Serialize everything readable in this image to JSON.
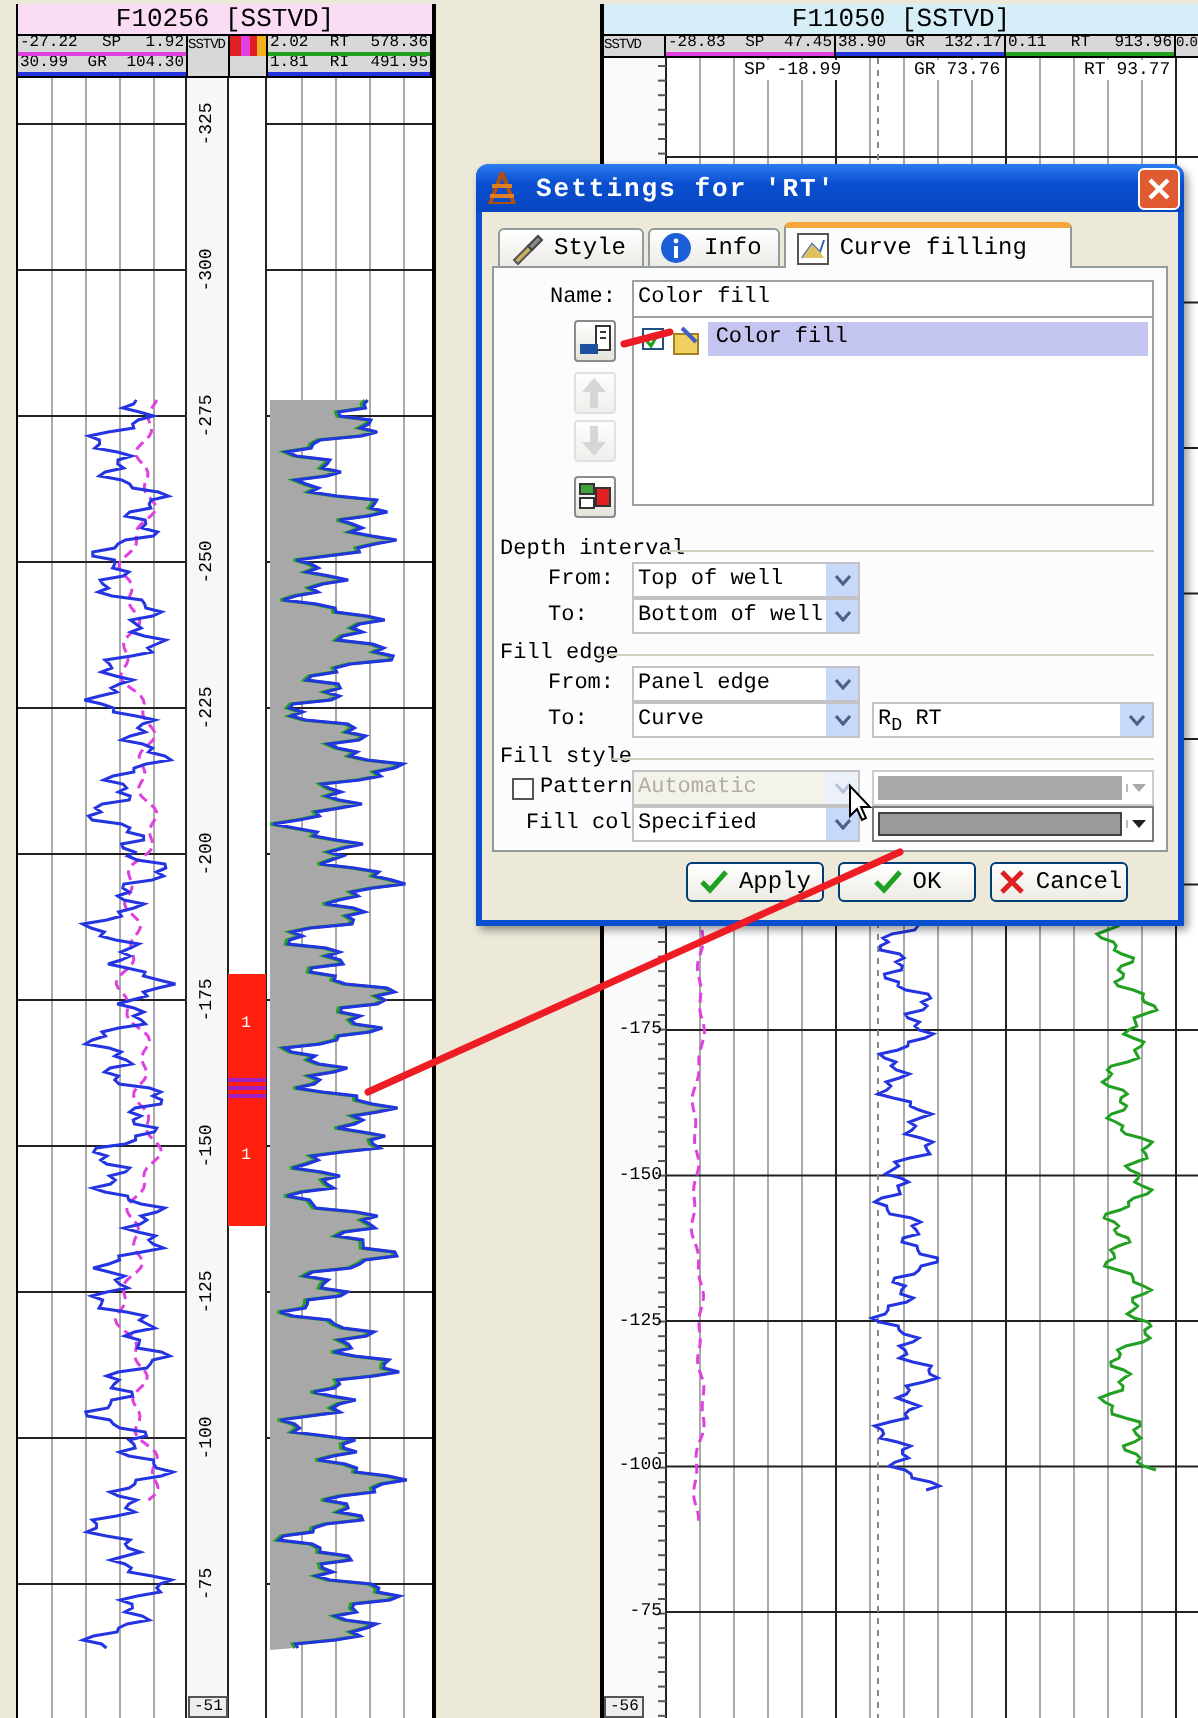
{
  "left_log": {
    "title": "F10256 [SSTVD]",
    "depth_header": "SSTVD",
    "curves": [
      {
        "min": "-27.22",
        "name": "SP",
        "max": "1.92",
        "color": "#e040e0"
      },
      {
        "min": "30.99",
        "name": "GR",
        "max": "104.30",
        "color": "#2434e0"
      }
    ],
    "fill_curves": [
      {
        "min": "2.02",
        "name": "RT",
        "max": "578.36",
        "color": "#22a022"
      },
      {
        "min": "1.81",
        "name": "RI",
        "max": "491.95",
        "color": "#2434e0"
      }
    ],
    "depth_labels": [
      "-325",
      "-300",
      "-275",
      "-250",
      "-225",
      "-200",
      "-175",
      "-150",
      "-125",
      "-100",
      "-75"
    ],
    "lithology_labels": [
      "1",
      "1"
    ],
    "bottom_label": "-51"
  },
  "right_log": {
    "title": "F11050 [SSTVD]",
    "depth_header": "SSTVD",
    "curves": [
      {
        "min": "-28.83",
        "name": "SP",
        "max": "47.45",
        "color": "#e040e0",
        "readout": "SP -18.99"
      },
      {
        "min": "38.90",
        "name": "GR",
        "max": "132.17",
        "color": "#2434e0",
        "readout": "GR 73.76"
      },
      {
        "min": "0.11",
        "name": "RT",
        "max": "913.96",
        "color": "#22a022",
        "readout": "RT 93.77"
      }
    ],
    "cut_column": "0.0",
    "depth_labels": [
      "-175",
      "-150",
      "-125",
      "-100",
      "-75"
    ],
    "bottom_label": "-56"
  },
  "dialog": {
    "title": "Settings for 'RT'",
    "tabs": [
      {
        "label": "Style",
        "kind": "brush",
        "selected": false
      },
      {
        "label": "Info",
        "kind": "info",
        "selected": false
      },
      {
        "label": "Curve filling",
        "kind": "fill",
        "selected": true
      }
    ],
    "name_label": "Name:",
    "name_value": "Color fill",
    "fills": [
      {
        "label": "Color fill",
        "checked": true,
        "selected": true
      }
    ],
    "side_buttons": [
      {
        "kind": "add",
        "disabled": false
      },
      {
        "kind": "up",
        "disabled": true
      },
      {
        "kind": "down",
        "disabled": true
      },
      {
        "kind": "delete",
        "disabled": false
      }
    ],
    "sections": [
      {
        "title": "Depth interval",
        "rows": [
          {
            "label": "From:",
            "value": "Top of well"
          },
          {
            "label": "To:",
            "value": "Bottom of well"
          }
        ]
      },
      {
        "title": "Fill edge",
        "rows": [
          {
            "label": "From:",
            "value": "Panel edge"
          },
          {
            "label": "To:",
            "value": "Curve",
            "curve": "R$_{D}$ RT"
          }
        ]
      }
    ],
    "fill_style": {
      "title": "Fill style",
      "pattern": {
        "label": "Pattern",
        "checked": false,
        "value": "Automatic",
        "disabled": true
      },
      "fill_color": {
        "label": "Fill col",
        "value": "Specified",
        "disabled": false
      }
    },
    "buttons": [
      {
        "kind": "apply",
        "label": "Apply"
      },
      {
        "kind": "ok",
        "label": "OK"
      },
      {
        "kind": "cancel",
        "label": "Cancel"
      }
    ]
  }
}
